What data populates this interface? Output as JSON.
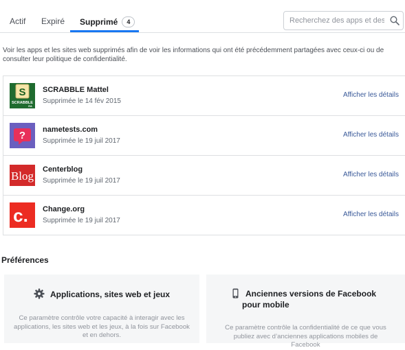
{
  "tabs": [
    {
      "label": "Actif"
    },
    {
      "label": "Expiré"
    },
    {
      "label": "Supprimé",
      "count": "4"
    }
  ],
  "search": {
    "placeholder": "Recherchez des apps et des s",
    "value": ""
  },
  "intro": "Voir les apps et les sites web supprimés afin de voir les informations qui ont été précédemment partagées avec ceux-ci ou de consulter leur politique de confidentialité.",
  "apps": [
    {
      "name": "SCRABBLE Mattel",
      "date": "Supprimée le 14 fév 2015",
      "link": "Afficher les détails",
      "logo": "scrabble-logo",
      "logo_text": "SCRABBLE"
    },
    {
      "name": "nametests.com",
      "date": "Supprimée le 19 juil 2017",
      "link": "Afficher les détails",
      "logo": "nametests-logo"
    },
    {
      "name": "Centerblog",
      "date": "Supprimée le 19 juil 2017",
      "link": "Afficher les détails",
      "logo": "centerblog-logo",
      "logo_text": "Blog"
    },
    {
      "name": "Change.org",
      "date": "Supprimée le 19 juil 2017",
      "link": "Afficher les détails",
      "logo": "change-logo",
      "logo_text": "c."
    }
  ],
  "preferences": {
    "title": "Préférences",
    "cards": [
      {
        "title": "Applications, sites web et jeux",
        "icon": "gear-icon",
        "desc": "Ce paramètre contrôle votre capacité à interagir avec les applications, les sites web et les jeux, à la fois sur Facebook et en dehors."
      },
      {
        "title": "Anciennes versions de Facebook pour mobile",
        "icon": "mobile-phone-icon",
        "desc": "Ce paramètre contrôle la confidentialité de ce que vous publiez avec d’anciennes applications mobiles de Facebook"
      }
    ]
  },
  "colors": {
    "accent": "#1877f2",
    "link": "#385898",
    "card_bg": "#f5f6f7"
  }
}
